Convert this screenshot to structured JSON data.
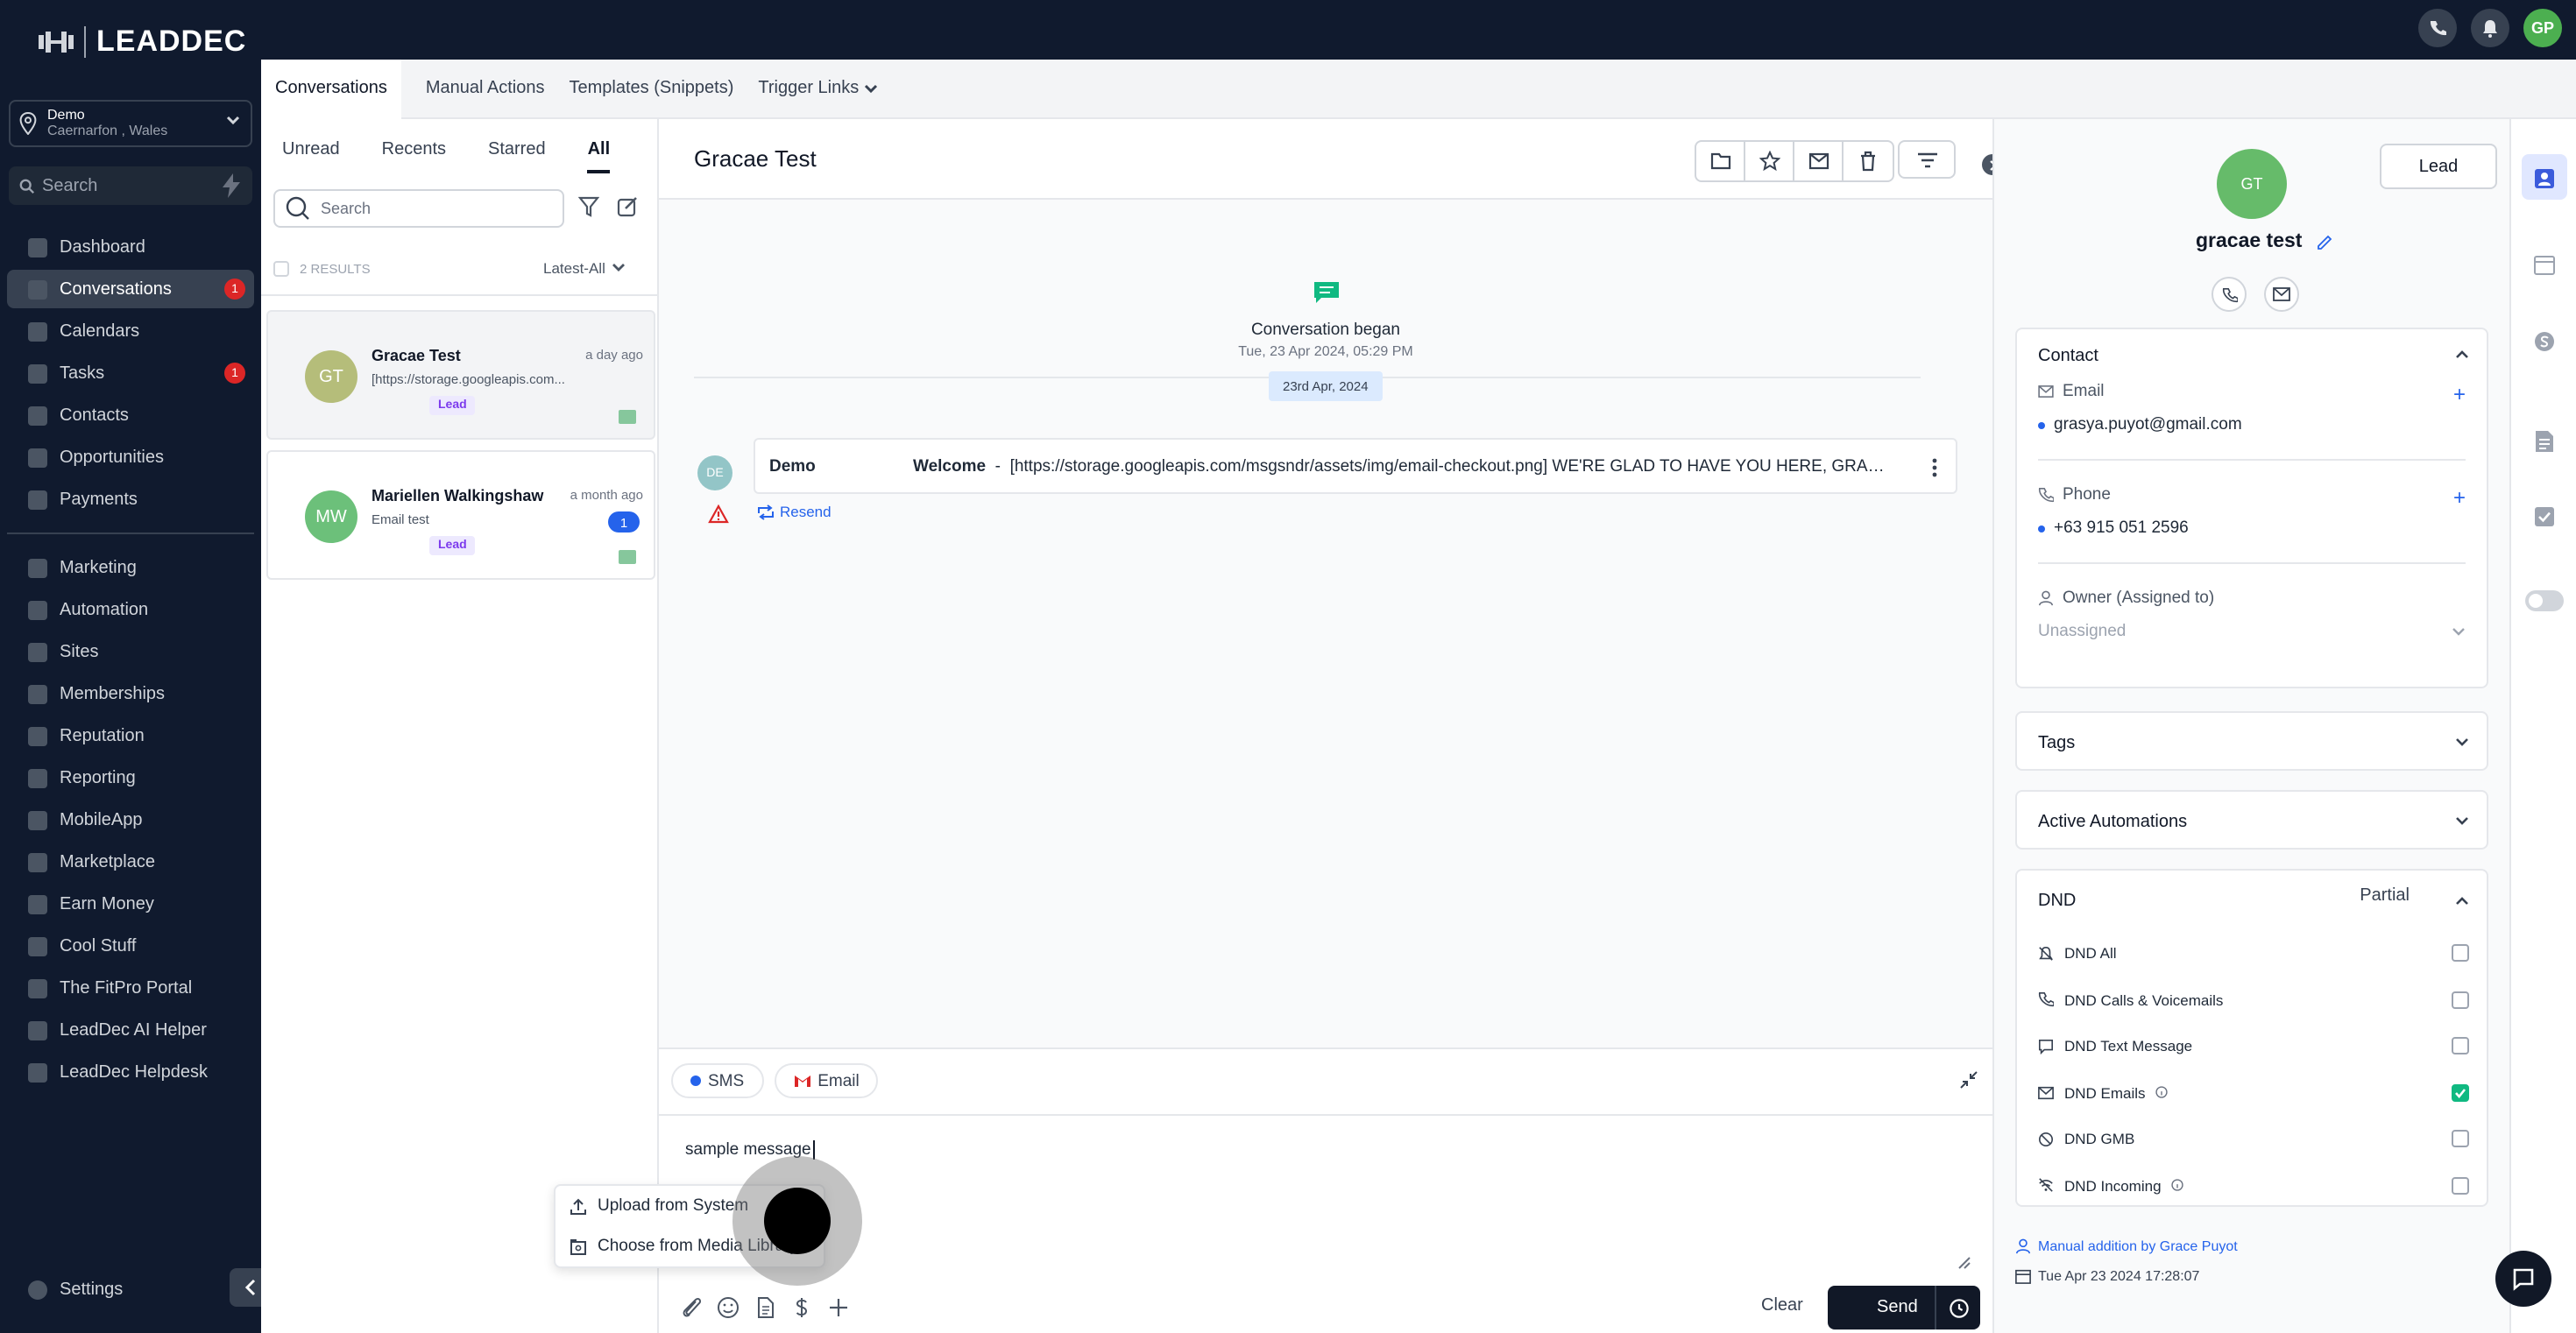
{
  "brand": {
    "name": "LEADDEC"
  },
  "location": {
    "name": "Demo",
    "sub": "Caernarfon , Wales"
  },
  "sidebar": {
    "search_placeholder": "Search",
    "items": [
      {
        "label": "Dashboard"
      },
      {
        "label": "Conversations",
        "badge": "1"
      },
      {
        "label": "Calendars"
      },
      {
        "label": "Tasks",
        "badge": "1"
      },
      {
        "label": "Contacts"
      },
      {
        "label": "Opportunities"
      },
      {
        "label": "Payments"
      }
    ],
    "items2": [
      {
        "label": "Marketing"
      },
      {
        "label": "Automation"
      },
      {
        "label": "Sites"
      },
      {
        "label": "Memberships"
      },
      {
        "label": "Reputation"
      },
      {
        "label": "Reporting"
      },
      {
        "label": "MobileApp"
      },
      {
        "label": "Marketplace"
      },
      {
        "label": "Earn Money"
      },
      {
        "label": "Cool Stuff"
      },
      {
        "label": "The FitPro Portal"
      },
      {
        "label": "LeadDec AI Helper"
      },
      {
        "label": "LeadDec Helpdesk"
      }
    ],
    "settings": "Settings"
  },
  "topbar": {
    "user_initials": "GP"
  },
  "tabs": [
    "Conversations",
    "Manual Actions",
    "Templates (Snippets)",
    "Trigger Links"
  ],
  "list": {
    "filters": [
      "Unread",
      "Recents",
      "Starred",
      "All"
    ],
    "search_placeholder": "Search",
    "results": "2 RESULTS",
    "sort": "Latest-All",
    "items": [
      {
        "initials": "GT",
        "name": "Gracae Test",
        "time": "a day ago",
        "preview": "[https://storage.googleapis.com...",
        "tag": "Lead",
        "avatar_color": "#b5bd7a"
      },
      {
        "initials": "MW",
        "name": "Mariellen Walkingshaw",
        "time": "a month ago",
        "preview": "Email test",
        "tag": "Lead",
        "count": "1",
        "avatar_color": "#6cc07a"
      }
    ]
  },
  "conversation": {
    "title": "Gracae Test",
    "began_label": "Conversation began",
    "began_time": "Tue, 23 Apr 2024, 05:29 PM",
    "date_chip": "23rd Apr, 2024",
    "message": {
      "avatar": "DE",
      "from": "Demo",
      "subject": "Welcome",
      "separator": "-",
      "body": "[https://storage.googleapis.com/msgsndr/assets/img/email-checkout.png] WE'RE GLAD TO HAVE YOU HERE, GRACAE TEST"
    },
    "resend": "Resend"
  },
  "composer": {
    "channels": [
      "SMS",
      "Email"
    ],
    "text": "sample message",
    "clear": "Clear",
    "send": "Send",
    "upload_menu": [
      "Upload from System",
      "Choose from Media Library"
    ]
  },
  "contact": {
    "lead_button": "Lead",
    "initials": "GT",
    "name": "gracae test",
    "section_contact": "Contact",
    "email_label": "Email",
    "email": "grasya.puyot@gmail.com",
    "phone_label": "Phone",
    "phone": "+63 915 051 2596",
    "owner_label": "Owner (Assigned to)",
    "owner_value": "Unassigned",
    "tags": "Tags",
    "active_automations": "Active Automations",
    "dnd": "DND",
    "dnd_status": "Partial",
    "dnd_rows": [
      {
        "label": "DND All",
        "checked": false
      },
      {
        "label": "DND Calls & Voicemails",
        "checked": false
      },
      {
        "label": "DND Text Message",
        "checked": false
      },
      {
        "label": "DND Emails",
        "checked": true
      },
      {
        "label": "DND GMB",
        "checked": false
      },
      {
        "label": "DND Incoming",
        "checked": false
      }
    ],
    "audit_by": "Manual addition by Grace Puyot",
    "audit_time": "Tue Apr 23 2024 17:28:07"
  },
  "colors": {
    "sidebar_bg": "#101a2e",
    "accent": "#2563eb",
    "send_bg": "#111827",
    "dnd_check": "#10b981"
  }
}
